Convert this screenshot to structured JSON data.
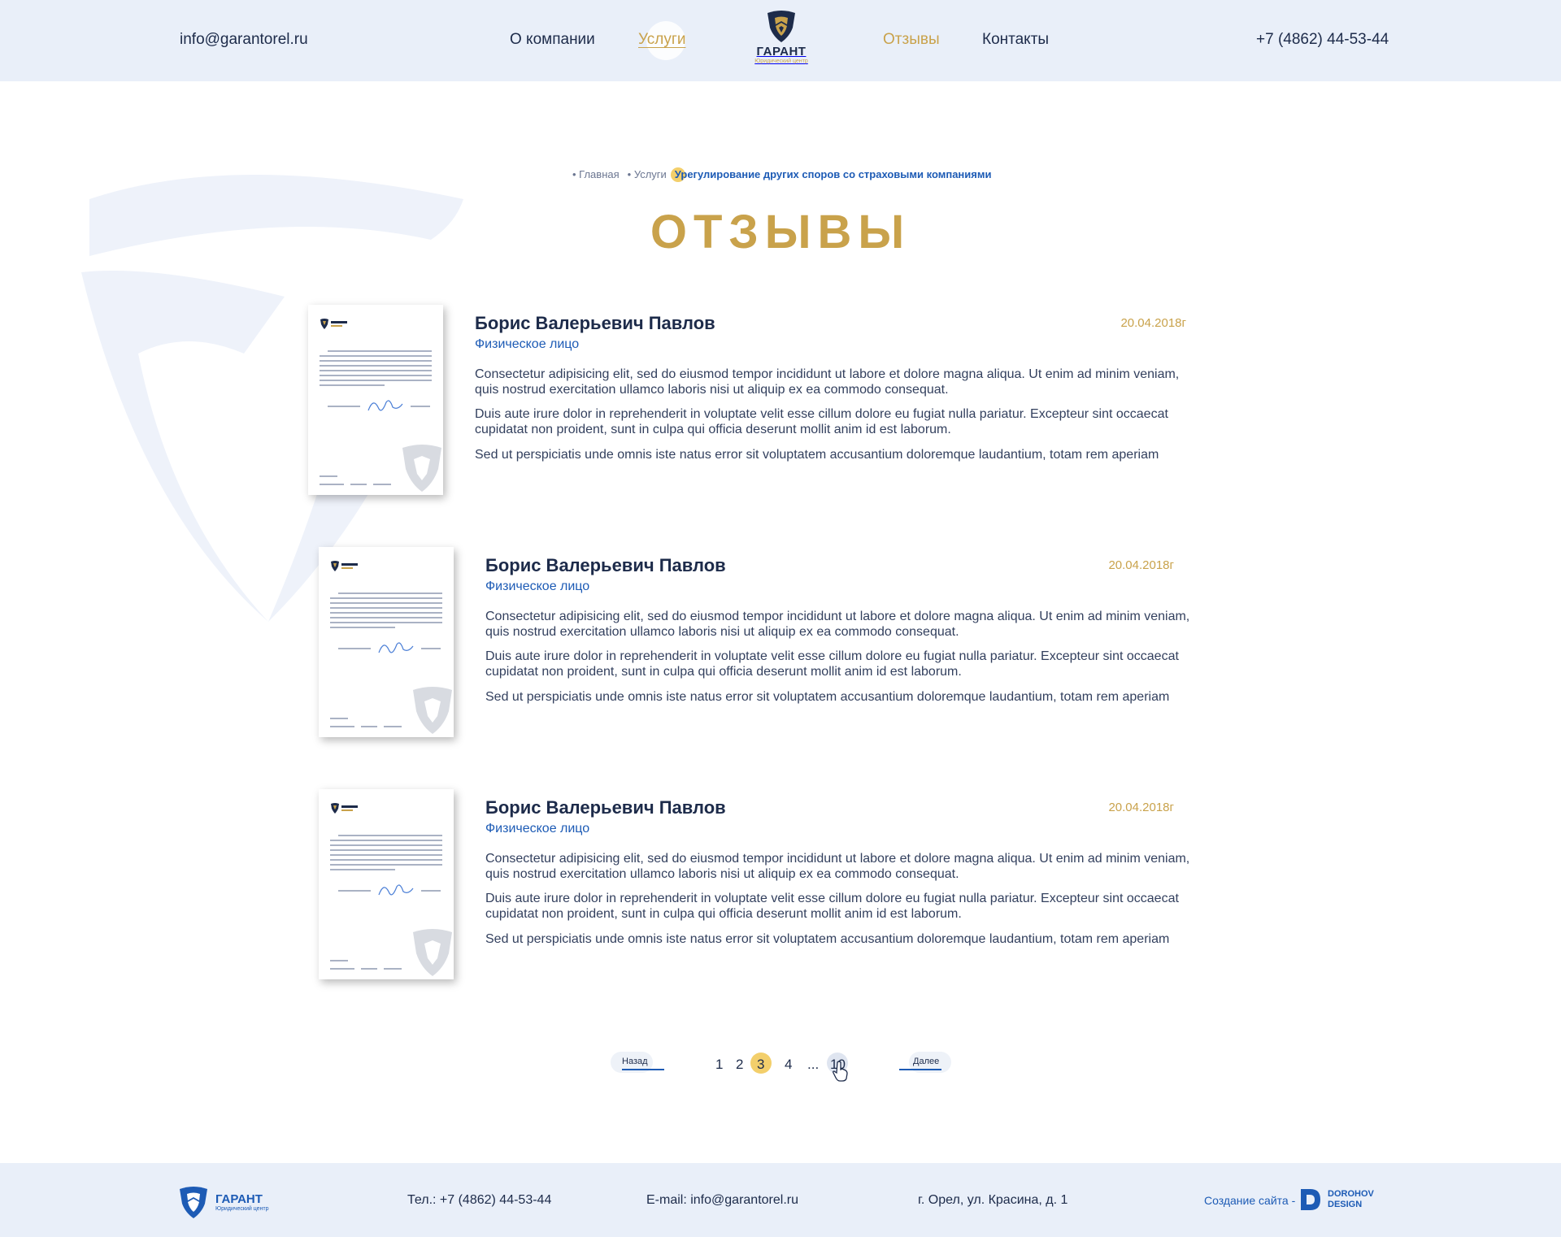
{
  "header": {
    "email": "info@garantorel.ru",
    "nav": {
      "about": "О компании",
      "services": "Услуги",
      "reviews": "Отзывы",
      "contacts": "Контакты"
    },
    "logo_brand": "ГАРАНТ",
    "logo_sub": "Юридический центр",
    "phone": "+7 (4862) 44-53-44"
  },
  "breadcrumb": {
    "items": [
      "• Главная",
      "• Услуги"
    ],
    "current": "Урегулирование других споров со страховыми компаниями"
  },
  "title": "ОТЗЫВЫ",
  "reviews": [
    {
      "name": "Борис Валерьевич Павлов",
      "role": "Физическое лицо",
      "date": "20.04.2018г",
      "paragraphs": [
        "Consectetur adipisicing elit, sed do eiusmod tempor incididunt ut labore et dolore magna aliqua. Ut enim ad minim veniam, quis nostrud exercitation ullamco laboris nisi ut aliquip ex ea commodo consequat.",
        "Duis aute irure dolor in reprehenderit in voluptate velit esse cillum dolore eu fugiat nulla pariatur. Excepteur sint occaecat cupidatat non proident, sunt in culpa qui officia deserunt mollit anim id est laborum.",
        "Sed ut perspiciatis unde omnis iste natus error sit voluptatem accusantium doloremque laudantium, totam rem aperiam"
      ]
    },
    {
      "name": "Борис Валерьевич Павлов",
      "role": "Физическое лицо",
      "date": "20.04.2018г",
      "paragraphs": [
        "Consectetur adipisicing elit, sed do eiusmod tempor incididunt ut labore et dolore magna aliqua. Ut enim ad minim veniam, quis nostrud exercitation ullamco laboris nisi ut aliquip ex ea commodo consequat.",
        "Duis aute irure dolor in reprehenderit in voluptate velit esse cillum dolore eu fugiat nulla pariatur. Excepteur sint occaecat cupidatat non proident, sunt in culpa qui officia deserunt mollit anim id est laborum.",
        "Sed ut perspiciatis unde omnis iste natus error sit voluptatem accusantium doloremque laudantium, totam rem aperiam"
      ]
    },
    {
      "name": "Борис Валерьевич Павлов",
      "role": "Физическое лицо",
      "date": "20.04.2018г",
      "paragraphs": [
        "Consectetur adipisicing elit, sed do eiusmod tempor incididunt ut labore et dolore magna aliqua. Ut enim ad minim veniam, quis nostrud exercitation ullamco laboris nisi ut aliquip ex ea commodo consequat.",
        "Duis aute irure dolor in reprehenderit in voluptate velit esse cillum dolore eu fugiat nulla pariatur. Excepteur sint occaecat cupidatat non proident, sunt in culpa qui officia deserunt mollit anim id est laborum.",
        "Sed ut perspiciatis unde omnis iste natus error sit voluptatem accusantium doloremque laudantium, totam rem aperiam"
      ]
    }
  ],
  "pagination": {
    "prev": "Назад",
    "next": "Далее",
    "pages": [
      "1",
      "2",
      "3",
      "4",
      "...",
      "10"
    ],
    "active": "3"
  },
  "footer": {
    "brand": "ГАРАНТ",
    "brand_sub": "Юридический центр",
    "tel": "Тел.: +7 (4862) 44-53-44",
    "email": "E-mail: info@garantorel.ru",
    "address": "г. Орел, ул. Красина, д. 1",
    "dev_label": "Создание сайта -",
    "dev_name_line1": "DOROHOV",
    "dev_name_line2": "DESIGN"
  },
  "colors": {
    "gold": "#c9a24b",
    "navy": "#1d2b4a",
    "blue": "#1d5bb5",
    "header_bg": "#e9eff9",
    "highlight": "#f3cf6b"
  }
}
